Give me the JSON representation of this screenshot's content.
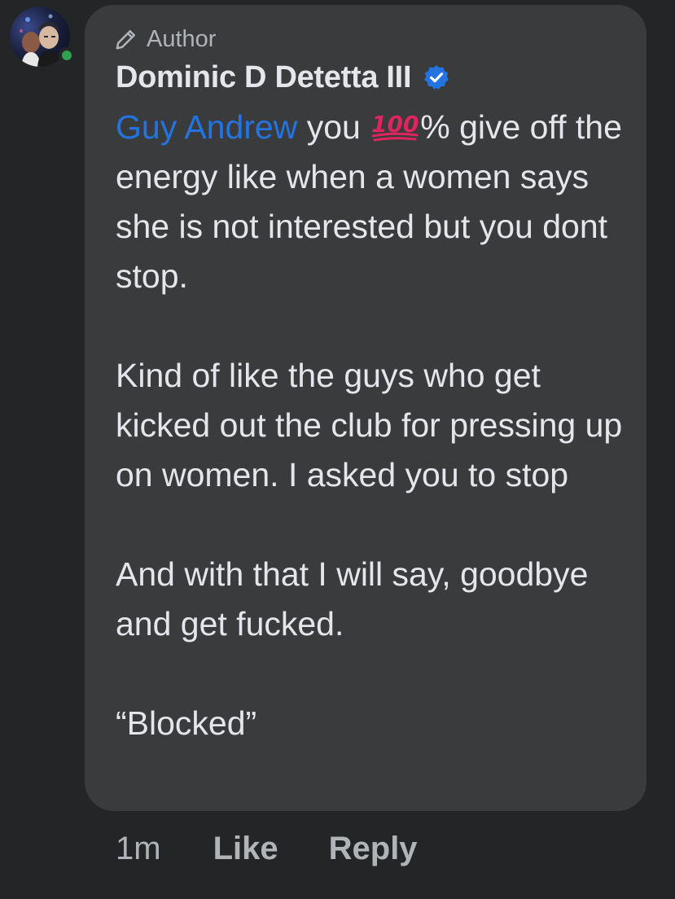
{
  "comment": {
    "author_badge": "Author",
    "author_name": "Dominic D Detetta III",
    "mention": "Guy Andrew",
    "text_after_mention_1": " you ",
    "emoji_hundred": "💯",
    "text_after_emoji": "% give off the energy like when a women says she is not interested but you dont stop.",
    "paragraph_2": "Kind of like the guys who get kicked out the club for pressing up on women. I asked you to stop",
    "paragraph_3": "And with that I will say, goodbye and get fucked.",
    "paragraph_4": "“Blocked”"
  },
  "actions": {
    "timestamp": "1m",
    "like_label": "Like",
    "reply_label": "Reply"
  },
  "colors": {
    "background": "#242526",
    "bubble": "#3a3b3c",
    "text": "#e4e6eb",
    "secondary_text": "#b0b3b8",
    "mention": "#2374e1",
    "verified": "#2374e1",
    "online": "#31a24c"
  },
  "icons": {
    "author_badge_icon": "pencil-icon",
    "verified_icon": "verified-badge-icon",
    "emoji": "hundred-points-icon"
  }
}
